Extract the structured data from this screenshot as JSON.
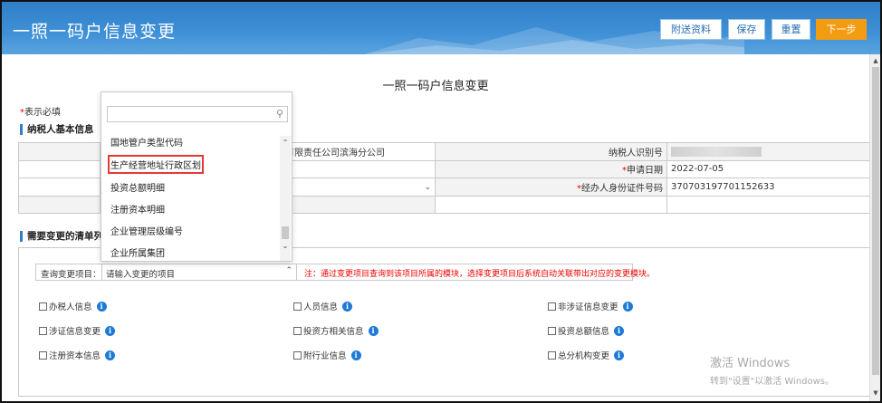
{
  "header": {
    "title": "一照一码户信息变更",
    "buttons": {
      "attach": "附送资料",
      "save": "保存",
      "reset": "重置",
      "next": "下一步"
    }
  },
  "page": {
    "title": "一照一码户信息变更",
    "required_note_star": "*",
    "required_note": "表示必填"
  },
  "sections": {
    "basic_info": "纳税人基本信息",
    "change_list": "需要变更的清单列表"
  },
  "basic_table": {
    "row1_value": "有限责任公司滨海分公司",
    "row1_label": "纳税人识别号",
    "row2_label_star": "*",
    "row2_label": "申请日期",
    "row2_value": "2022-07-05",
    "row3_label_star": "*",
    "row3_label": "经办人身份证件号码",
    "row3_value": "370703197701152633"
  },
  "query": {
    "label": "查询变更项目：",
    "placeholder": "请输入变更的项目",
    "note": "注：通过变更项目查询到该项目所属的模块，选择变更项目后系统自动关联带出对应的变更模块。"
  },
  "checkboxes": [
    "办税人信息",
    "人员信息",
    "非涉证信息变更",
    "涉证信息变更",
    "投资方相关信息",
    "投资总额信息",
    "注册资本信息",
    "附行业信息",
    "总分机构变更"
  ],
  "dropdown": {
    "items": [
      "国地管户类型代码",
      "生产经营地址行政区划",
      "投资总额明细",
      "注册资本明细",
      "企业管理层级编号",
      "企业所属集团"
    ]
  },
  "icons": {
    "search": "magnifier-icon",
    "info": "info-icon",
    "checkbox": "checkbox-icon"
  },
  "colors": {
    "header_blue": "#2f7fc9",
    "next_orange": "#f39c12",
    "required_red": "#e00000",
    "info_blue": "#1e7ad6"
  },
  "watermark": {
    "line1": "激活 Windows",
    "line2": "转到\"设置\"以激活 Windows。"
  }
}
